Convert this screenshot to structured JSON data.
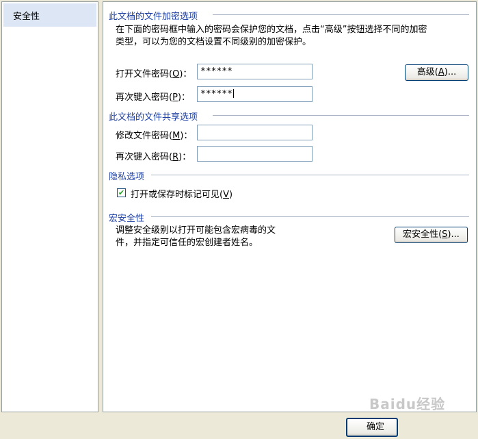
{
  "sidebar": {
    "items": [
      {
        "label": "安全性"
      }
    ]
  },
  "encryption": {
    "title": "此文档的文件加密选项",
    "desc_line1": "在下面的密码框中输入的密码会保护您的文档，点击“高级”按钮选择不同的加密",
    "desc_line2": "类型，可以为您的文档设置不同级别的加密保护。",
    "open_label": "打开文件密码",
    "open_key": "O",
    "open_value": "******",
    "reenter_label": "再次键入密码",
    "reenter_key": "P",
    "reenter_value": "******",
    "advanced_label": "高级",
    "advanced_key": "A"
  },
  "sharing": {
    "title": "此文档的文件共享选项",
    "modify_label": "修改文件密码",
    "modify_key": "M",
    "modify_value": "",
    "reenter_label": "再次键入密码",
    "reenter_key": "R",
    "reenter_value": ""
  },
  "privacy": {
    "title": "隐私选项",
    "visible_markup_label": "打开或保存时标记可见",
    "visible_markup_key": "V",
    "visible_markup_checked": true
  },
  "macro": {
    "title": "宏安全性",
    "desc_line1": "调整安全级别以打开可能包含宏病毒的文",
    "desc_line2": "件，并指定可信任的宏创建者姓名。",
    "button_label": "宏安全性",
    "button_key": "S"
  },
  "footer": {
    "ok_label": "确定"
  },
  "watermark": {
    "text": "Baidu经验"
  },
  "colors": {
    "section_title": "#1c3fa3",
    "selected_item": "#dde6f5",
    "dialog_bg": "#ece9d8"
  },
  "icons": {
    "checkbox": "check-icon"
  }
}
